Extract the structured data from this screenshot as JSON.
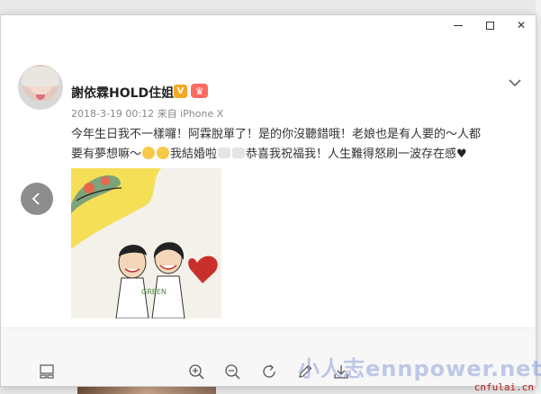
{
  "window": {
    "minimize_label": "Minimize",
    "maximize_label": "Maximize",
    "close_label": "Close",
    "close_glyph": "✕"
  },
  "post": {
    "username": "謝依霖HOLD住姐",
    "v_badge": "V",
    "crown_badge": "♛",
    "timestamp": "2018-3-19 00:12",
    "source": "来自 iPhone X",
    "text_line1": "今年生日我不一樣囉！阿霖脫單了！是的你沒聽錯哦！老娘也是有人要的～人都",
    "text_line2_a": "要有夢想嘛～",
    "text_line2_b": "我結婚啦",
    "text_line2_c": "恭喜我祝福我！人生難得怒刷一波存在感",
    "heart": "♥"
  },
  "photo": {
    "label_green": "GREEN"
  },
  "toolbar": {
    "icons": [
      "gallery-view-icon",
      "zoom-in-icon",
      "zoom-out-icon",
      "rotate-icon",
      "edit-icon",
      "download-icon"
    ]
  },
  "watermarks": {
    "overlay": "小人志ennpower.net",
    "bottom_right": "cnfulai.cn"
  },
  "colors": {
    "accent_badge": "#f6a623",
    "crown_badge": "#ff6b5e",
    "watermark_bottom": "#b91c1c"
  }
}
